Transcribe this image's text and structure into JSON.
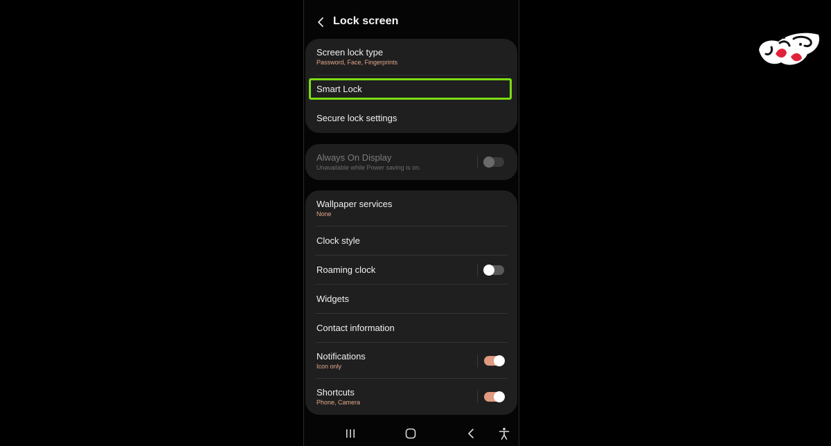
{
  "header": {
    "title": "Lock screen"
  },
  "group1": {
    "screen_lock_type": {
      "label": "Screen lock type",
      "sub": "Password, Face, Fingerprints"
    },
    "smart_lock": {
      "label": "Smart Lock"
    },
    "secure_lock_settings": {
      "label": "Secure lock settings"
    }
  },
  "group2": {
    "always_on_display": {
      "label": "Always On Display",
      "sub": "Unavailable while Power saving is on.",
      "enabled": false
    }
  },
  "group3": {
    "wallpaper_services": {
      "label": "Wallpaper services",
      "sub": "None"
    },
    "clock_style": {
      "label": "Clock style"
    },
    "roaming_clock": {
      "label": "Roaming clock",
      "on": false
    },
    "widgets": {
      "label": "Widgets"
    },
    "contact_information": {
      "label": "Contact information"
    },
    "notifications": {
      "label": "Notifications",
      "sub": "Icon only",
      "on": true
    },
    "shortcuts": {
      "label": "Shortcuts",
      "sub": "Phone, Camera",
      "on": true
    }
  },
  "navbar": {
    "icons": [
      "recent-apps-icon",
      "home-icon",
      "back-icon",
      "accessibility-icon"
    ]
  },
  "colors": {
    "highlight": "#7ddc12",
    "accent": "#df9a80",
    "subtext": "#e3a98b",
    "card": "#1f1f1f"
  },
  "watermark": {
    "text": "گوشی آنلاین"
  }
}
